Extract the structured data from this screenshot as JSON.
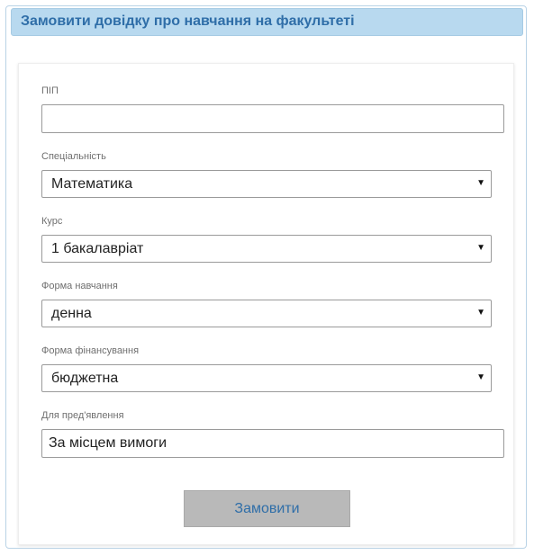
{
  "header": {
    "title": "Замовити довідку про навчання на факультеті"
  },
  "form": {
    "pib": {
      "label": "ПІП",
      "value": ""
    },
    "specialty": {
      "label": "Спеціальність",
      "selected": "Математика"
    },
    "course": {
      "label": "Курс",
      "selected": "1 бакалавріат"
    },
    "study_form": {
      "label": "Форма навчання",
      "selected": "денна"
    },
    "funding_form": {
      "label": "Форма фінансування",
      "selected": "бюджетна"
    },
    "destination": {
      "label": "Для пред'явлення",
      "value": "За місцем вимоги"
    },
    "submit_label": "Замовити"
  },
  "icons": {
    "dropdown": "chevron-down-icon"
  },
  "colors": {
    "title_bg": "#b8d9ef",
    "title_text": "#2f6ea8",
    "button_bg": "#b9b9b9",
    "button_text": "#2f6ea8"
  }
}
